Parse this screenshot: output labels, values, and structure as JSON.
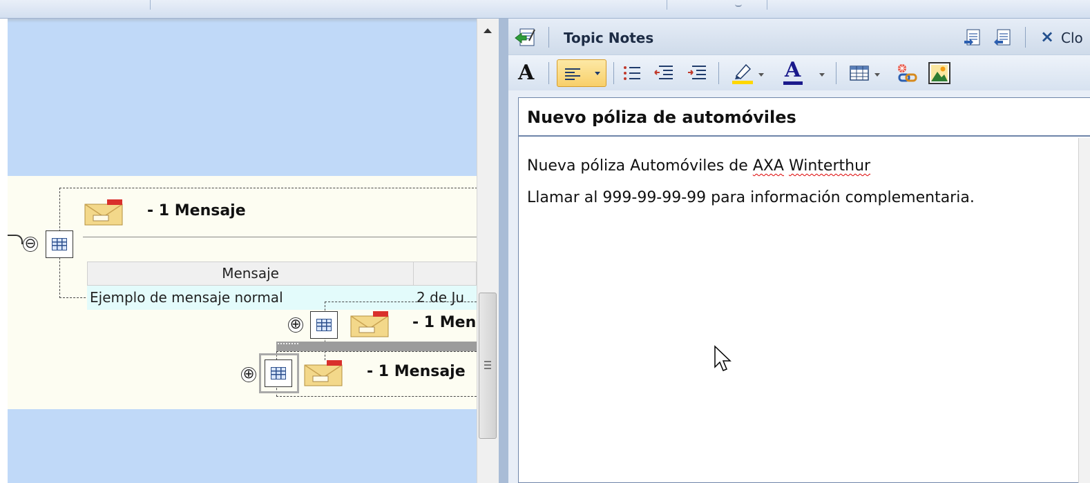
{
  "topic_1": {
    "title": "- 1 Mensaje",
    "table": {
      "columns": [
        "Mensaje",
        ""
      ],
      "rows": [
        [
          "Ejemplo de mensaje normal",
          "2 de Ju"
        ]
      ]
    },
    "collapse_glyph": "⊖"
  },
  "subtopic_1": {
    "title": "- 1 Men",
    "expand_glyph": "⊕"
  },
  "subtopic_2": {
    "title": "- 1 Mensaje",
    "expand_glyph": "⊕"
  },
  "notes_pane": {
    "title": "Topic Notes",
    "close_label": "Clo",
    "close_glyph": "×",
    "subject": "Nuevo póliza de automóviles",
    "body": {
      "line1_prefix": "Nueva póliza Automóviles de ",
      "line1_word1": "AXA",
      "line1_word2": "Winterthur",
      "line2": "Llamar al 999-99-99-99 para información complementaria."
    },
    "toolbar": {
      "font_glyph": "A",
      "font_color_glyph": "A",
      "highlight_color": "#ffd700",
      "font_color": "#1a1a8c"
    }
  },
  "icons": [
    "mail-icon",
    "table-icon",
    "add-note-icon",
    "export-note-icon",
    "import-note-icon",
    "close-icon",
    "font-icon",
    "align-left-icon",
    "bullet-list-icon",
    "outdent-icon",
    "indent-icon",
    "highlight-icon",
    "font-color-icon",
    "insert-table-icon",
    "hyperlink-icon",
    "insert-image-icon",
    "mouse-cursor-icon"
  ]
}
